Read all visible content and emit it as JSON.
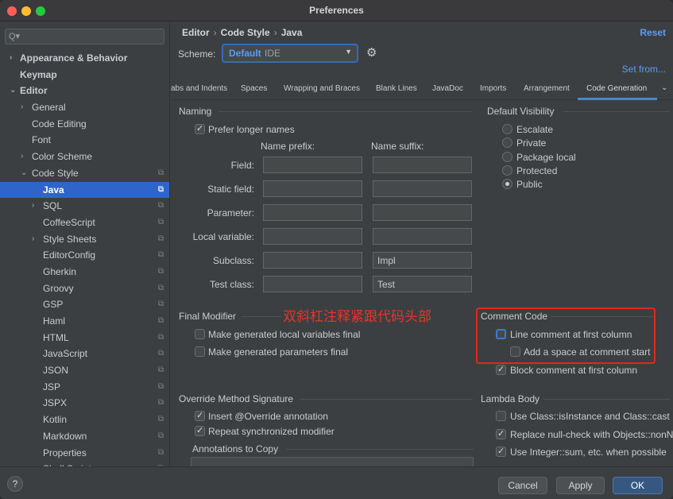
{
  "window": {
    "title": "Preferences"
  },
  "sidebar": {
    "items": [
      {
        "label": "Appearance & Behavior",
        "arrow": "›",
        "bold": true
      },
      {
        "label": "Keymap",
        "arrow": "",
        "bold": true
      },
      {
        "label": "Editor",
        "arrow": "⌄",
        "bold": true
      },
      {
        "label": "General",
        "arrow": "›",
        "bold": false
      },
      {
        "label": "Code Editing",
        "arrow": "",
        "bold": false
      },
      {
        "label": "Font",
        "arrow": "",
        "bold": false
      },
      {
        "label": "Color Scheme",
        "arrow": "›",
        "bold": false
      },
      {
        "label": "Code Style",
        "arrow": "⌄",
        "bold": false
      },
      {
        "label": "Java",
        "arrow": "",
        "bold": true
      },
      {
        "label": "SQL",
        "arrow": "›",
        "bold": false
      },
      {
        "label": "CoffeeScript",
        "arrow": "",
        "bold": false
      },
      {
        "label": "Style Sheets",
        "arrow": "›",
        "bold": false
      },
      {
        "label": "EditorConfig",
        "arrow": "",
        "bold": false
      },
      {
        "label": "Gherkin",
        "arrow": "",
        "bold": false
      },
      {
        "label": "Groovy",
        "arrow": "",
        "bold": false
      },
      {
        "label": "GSP",
        "arrow": "",
        "bold": false
      },
      {
        "label": "Haml",
        "arrow": "",
        "bold": false
      },
      {
        "label": "HTML",
        "arrow": "",
        "bold": false
      },
      {
        "label": "JavaScript",
        "arrow": "",
        "bold": false
      },
      {
        "label": "JSON",
        "arrow": "",
        "bold": false
      },
      {
        "label": "JSP",
        "arrow": "",
        "bold": false
      },
      {
        "label": "JSPX",
        "arrow": "",
        "bold": false
      },
      {
        "label": "Kotlin",
        "arrow": "",
        "bold": false
      },
      {
        "label": "Markdown",
        "arrow": "",
        "bold": false
      },
      {
        "label": "Properties",
        "arrow": "",
        "bold": false
      },
      {
        "label": "Shell Script",
        "arrow": "",
        "bold": false
      }
    ],
    "search_icon": "Q▾"
  },
  "main": {
    "breadcrumb": [
      "Editor",
      "Code Style",
      "Java"
    ],
    "reset_label": "Reset",
    "scheme_label": "Scheme:",
    "scheme_name": "Default",
    "scheme_type": "IDE",
    "set_from_label": "Set from...",
    "tabs": [
      "abs and Indents",
      "Spaces",
      "Wrapping and Braces",
      "Blank Lines",
      "JavaDoc",
      "Imports",
      "Arrangement",
      "Code Generation"
    ],
    "naming": {
      "title": "Naming",
      "prefer_longer": "Prefer longer names",
      "prefix_header": "Name prefix:",
      "suffix_header": "Name suffix:",
      "rows": [
        {
          "label": "Field:",
          "prefix": "",
          "suffix": ""
        },
        {
          "label": "Static field:",
          "prefix": "",
          "suffix": ""
        },
        {
          "label": "Parameter:",
          "prefix": "",
          "suffix": ""
        },
        {
          "label": "Local variable:",
          "prefix": "",
          "suffix": ""
        },
        {
          "label": "Subclass:",
          "prefix": "",
          "suffix": "Impl"
        },
        {
          "label": "Test class:",
          "prefix": "",
          "suffix": "Test"
        }
      ]
    },
    "default_visibility": {
      "title": "Default Visibility",
      "options": [
        "Escalate",
        "Private",
        "Package local",
        "Protected",
        "Public"
      ],
      "selected": "Public"
    },
    "final_modifier": {
      "title": "Final Modifier",
      "local_vars": "Make generated local variables final",
      "params": "Make generated parameters final"
    },
    "comment_code": {
      "title": "Comment Code",
      "line_first_col": "Line comment at first column",
      "add_space": "Add a space at comment start",
      "block_first_col": "Block comment at first column"
    },
    "annotation_note": "双斜杠注释紧跟代码头部",
    "override": {
      "title": "Override Method Signature",
      "insert_override": "Insert @Override annotation",
      "repeat_sync": "Repeat synchronized modifier",
      "annotations_to_copy": "Annotations to Copy"
    },
    "lambda": {
      "title": "Lambda Body",
      "isinstance": "Use Class::isInstance and Class::cast",
      "nullcheck": "Replace null-check with Objects::nonN",
      "integer_sum": "Use Integer::sum, etc. when possible"
    }
  },
  "footer": {
    "help": "?",
    "cancel": "Cancel",
    "apply": "Apply",
    "ok": "OK"
  },
  "colors": {
    "accent": "#2f65ca",
    "link": "#589df6",
    "annotation": "#e3261d"
  }
}
